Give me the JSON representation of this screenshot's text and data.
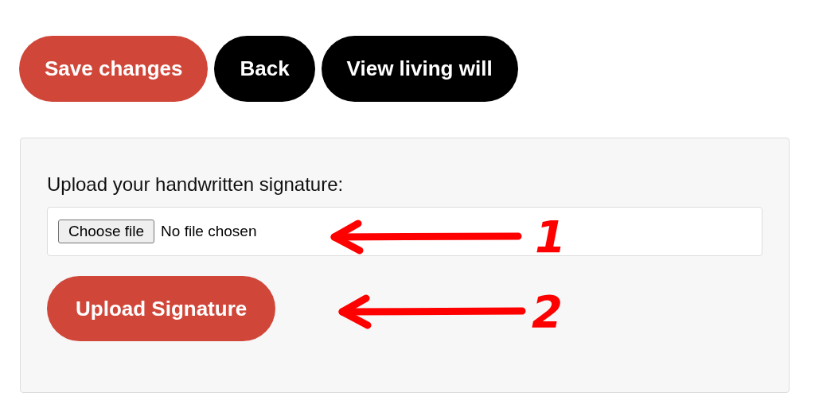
{
  "actions": [
    {
      "label": "Save changes",
      "kind": "primary"
    },
    {
      "label": "Back",
      "kind": "dark"
    },
    {
      "label": "View living will",
      "kind": "dark"
    }
  ],
  "signature_panel": {
    "label": "Upload your handwritten signature:",
    "file_input": {
      "button_label": "Choose file",
      "status": "No file chosen"
    },
    "upload_button": "Upload Signature"
  },
  "annotations": [
    {
      "number": "1"
    },
    {
      "number": "2"
    }
  ]
}
